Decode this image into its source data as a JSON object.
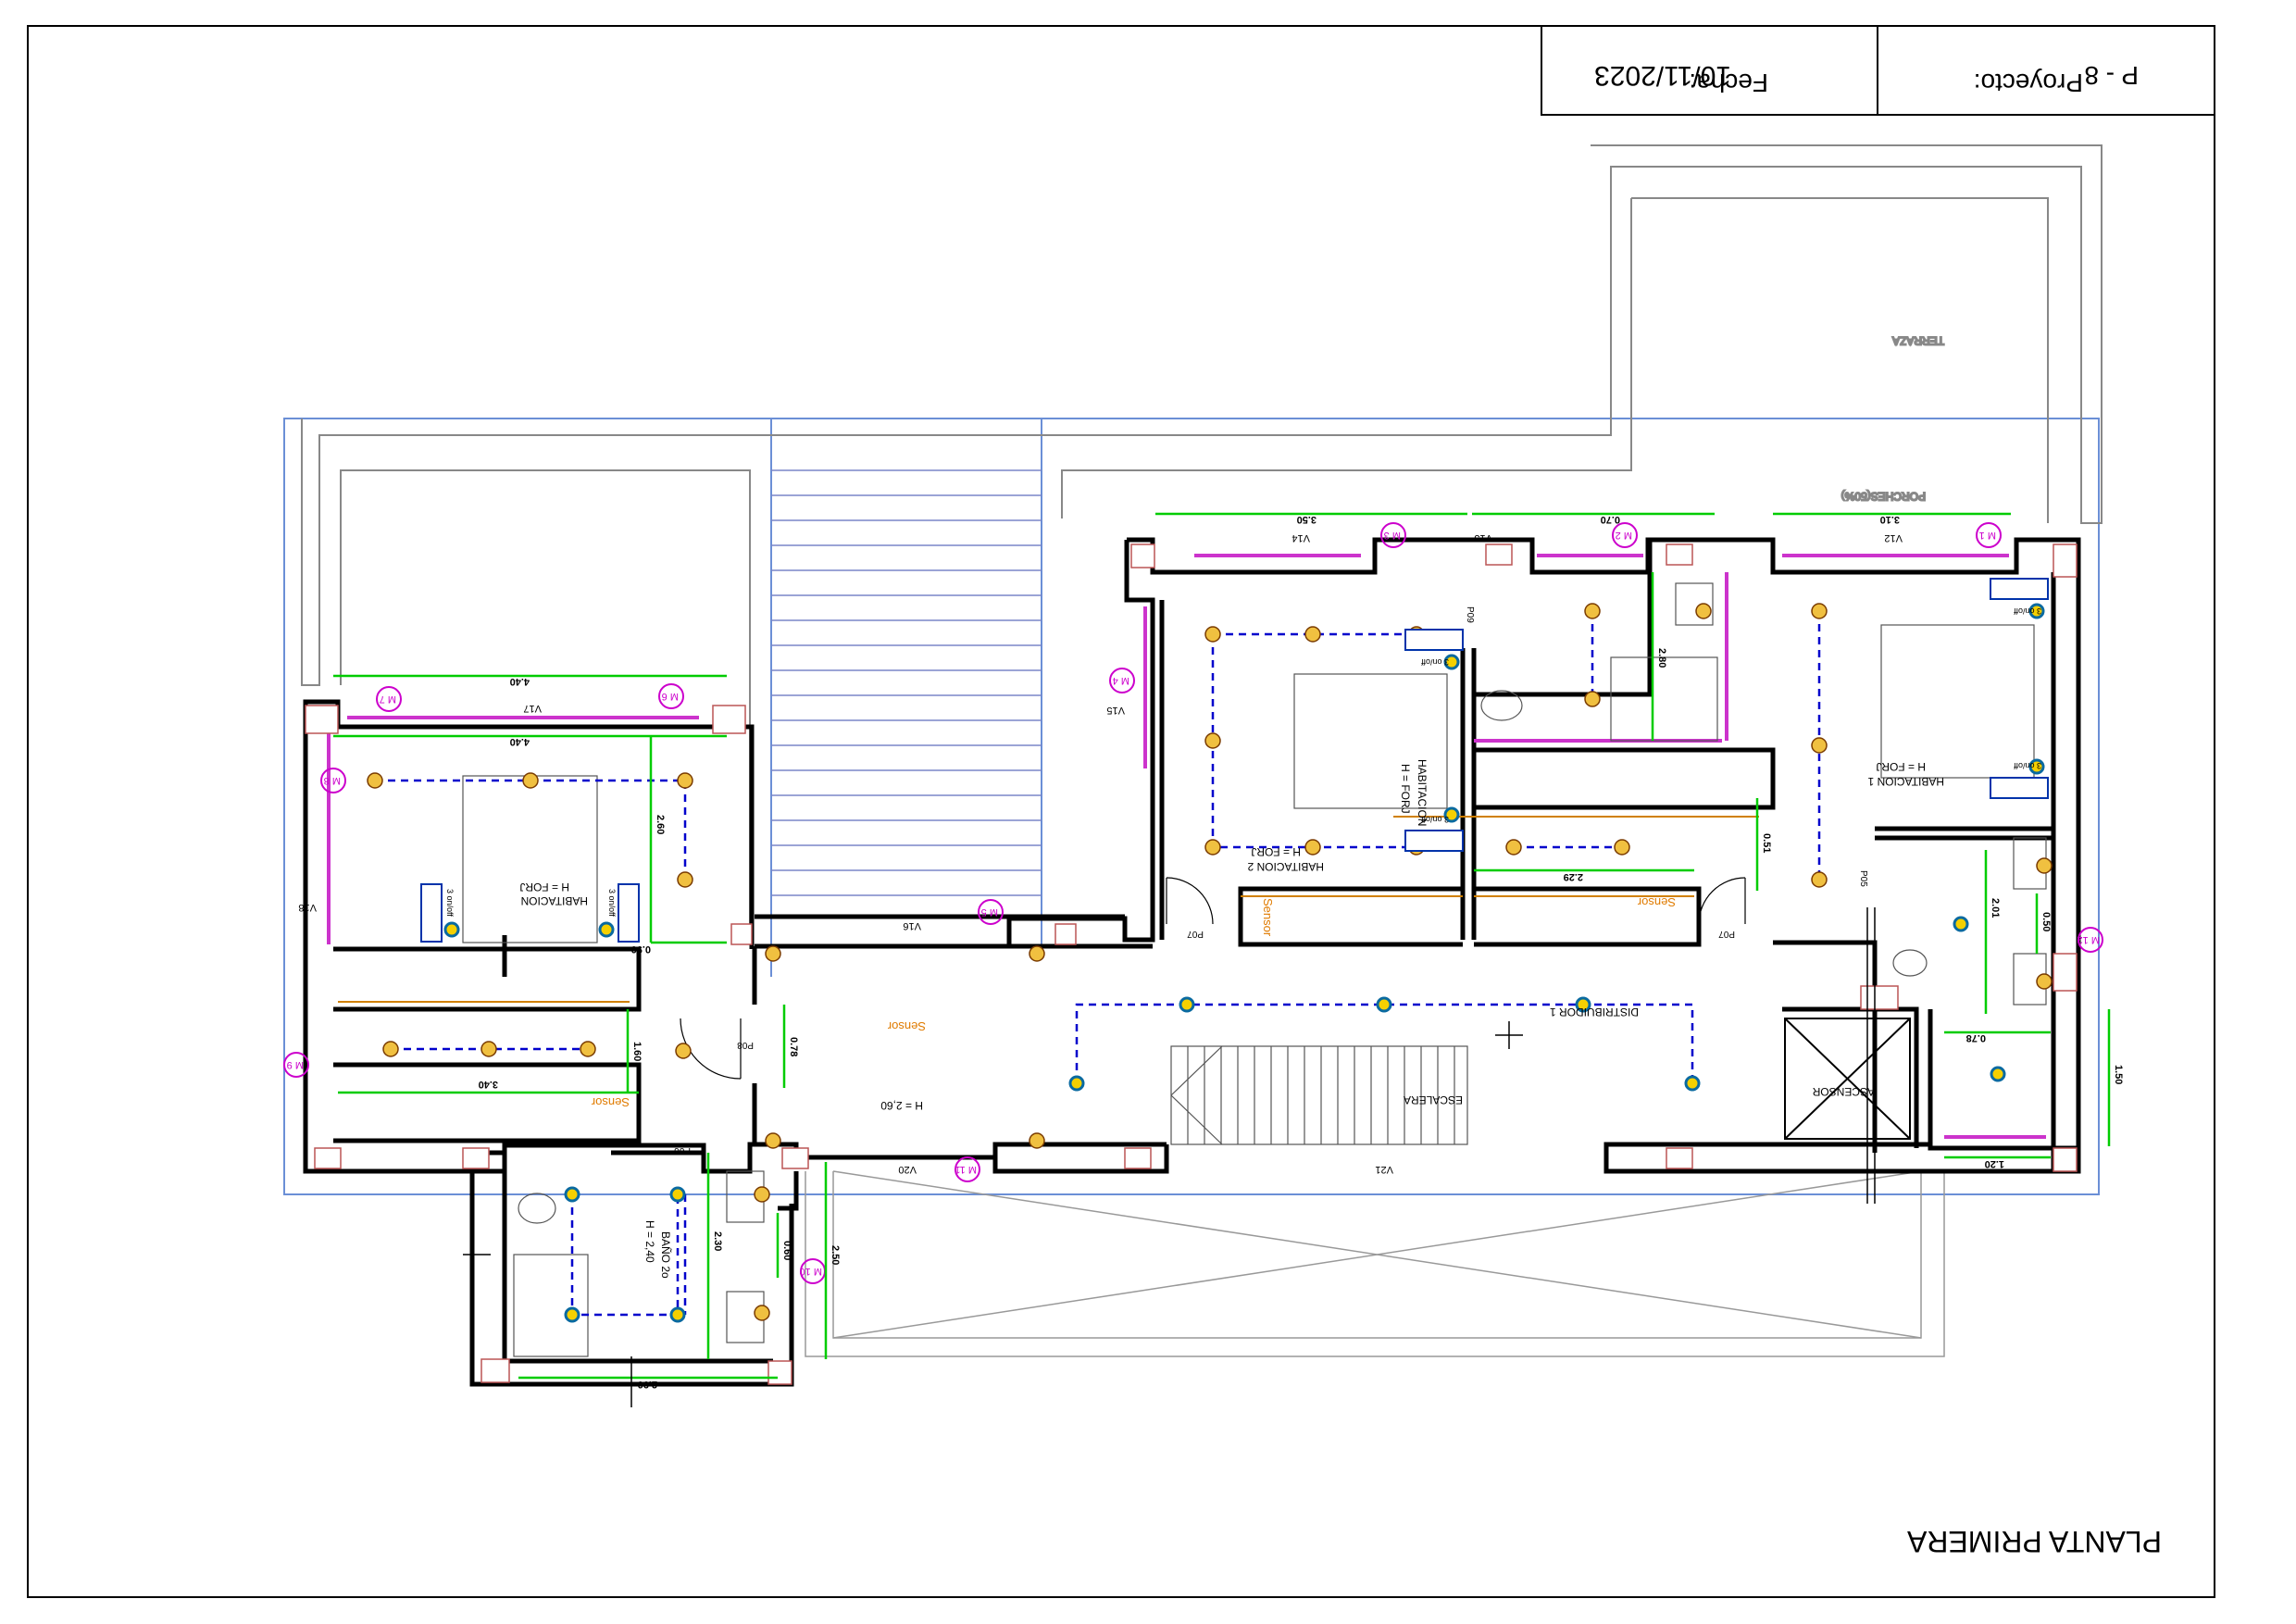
{
  "title_block": {
    "project_label": "Proyecto:",
    "project_value": "P - 8",
    "date_label": "Fecha:",
    "date_value": "10/11/2023"
  },
  "sheet_title": "PLANTA PRIMERA",
  "rooms": {
    "terraza": "TERRAZA",
    "porches": "PORCHES(50%)",
    "hab1": "HABITACION 1",
    "hab2": "HABITACION 2",
    "hab3": "HABITACION",
    "hab4": "HABITACION",
    "distribuidor": "DISTRIBUIDOR 1",
    "escalera": "ESCALERA",
    "ascensor": "ASCENSOR",
    "bano": "BAÑO 2o",
    "h_forj": "H = FORJ",
    "h_260": "H = 2,60",
    "h_240": "H = 2,40"
  },
  "sensors": [
    "Sensor",
    "Sensor",
    "Sensor",
    "Sensor"
  ],
  "switch_label": "3 on/off",
  "windows": {
    "V12": "V12",
    "V13": "V13",
    "V14": "V14",
    "V15": "V15",
    "V16": "V16",
    "V17": "V17",
    "V18": "V18",
    "V20": "V20",
    "V21": "V21"
  },
  "doors": {
    "P05": "P05",
    "P06": "P06",
    "P07a": "P07",
    "P07b": "P07",
    "P08": "P08",
    "P09": "P09"
  },
  "markers": [
    "M 1",
    "M 2",
    "M 3",
    "M 4",
    "M 5",
    "M 6",
    "M 7",
    "M 8",
    "M 9",
    "M 10",
    "M 11",
    "M 12"
  ],
  "dimensions": {
    "d1": "3.10",
    "d2": "0.70",
    "d3": "3.50",
    "d4": "4.40",
    "d5": "4.40",
    "d6": "2.60",
    "d7": "0.90",
    "d8": "2.29",
    "d9": "0.51",
    "d10": "2.80",
    "d11": "2.01",
    "d12": "0.50",
    "d13": "1.50",
    "d14": "0.78",
    "d15": "1.20",
    "d16": "0.78",
    "d17": "3.40",
    "d18": "1.60",
    "d19": "2.30",
    "d20": "2.50",
    "d21": "0.60",
    "d22": "2.90"
  },
  "colors": {
    "dimension": "#00cc00",
    "circuit": "#0000cc",
    "light_fixture": "#cc6600",
    "marker": "#cc00cc",
    "wall": "#000000",
    "sensor_text": "#e07b00",
    "window_tint": "#cc33cc",
    "lot_outline": "#6b8fd6"
  }
}
